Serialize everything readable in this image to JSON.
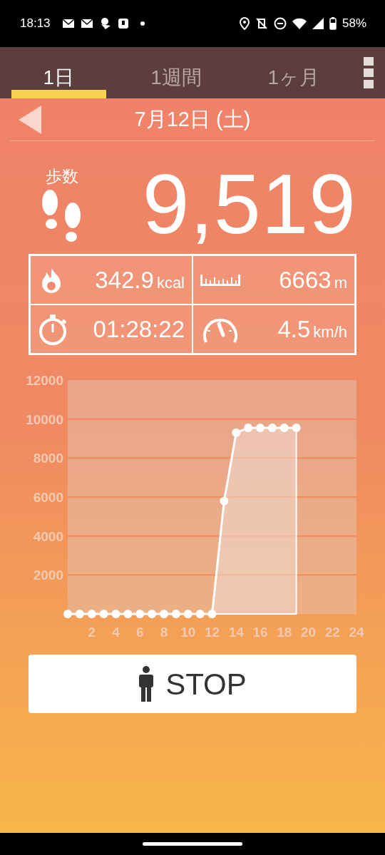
{
  "status_bar": {
    "time": "18:13",
    "battery": "58%"
  },
  "tabs": [
    {
      "label": "1日",
      "selected": true
    },
    {
      "label": "1週間",
      "selected": false
    },
    {
      "label": "1ヶ月",
      "selected": false
    }
  ],
  "date": "7月12日 (土)",
  "steps": {
    "label": "歩数",
    "value": "9,519"
  },
  "stats": [
    {
      "kind": "calories",
      "value": "342.9",
      "unit": "kcal"
    },
    {
      "kind": "distance",
      "value": "6663",
      "unit": "m"
    },
    {
      "kind": "time",
      "value": "01:28:22"
    },
    {
      "kind": "speed",
      "value": "4.5",
      "unit": "km/h"
    }
  ],
  "chart_data": {
    "type": "area",
    "grid": true,
    "x": [
      0,
      1,
      2,
      3,
      4,
      5,
      6,
      7,
      8,
      9,
      10,
      11,
      12,
      13,
      14,
      15,
      16,
      17,
      18,
      19
    ],
    "series": [
      {
        "color": "#ffffff",
        "marker": true,
        "values": [
          0,
          0,
          0,
          0,
          0,
          0,
          0,
          0,
          0,
          0,
          0,
          0,
          0,
          5800,
          9300,
          9550,
          9550,
          9550,
          9550,
          9550
        ]
      }
    ],
    "xlim": [
      0,
      24
    ],
    "ylim": [
      0,
      12000
    ],
    "xticks": [
      2,
      4,
      6,
      8,
      10,
      12,
      14,
      16,
      18,
      20,
      22,
      24
    ],
    "yticks": [
      2000,
      4000,
      6000,
      8000,
      10000,
      12000
    ]
  },
  "stop_button": {
    "label": "STOP"
  }
}
